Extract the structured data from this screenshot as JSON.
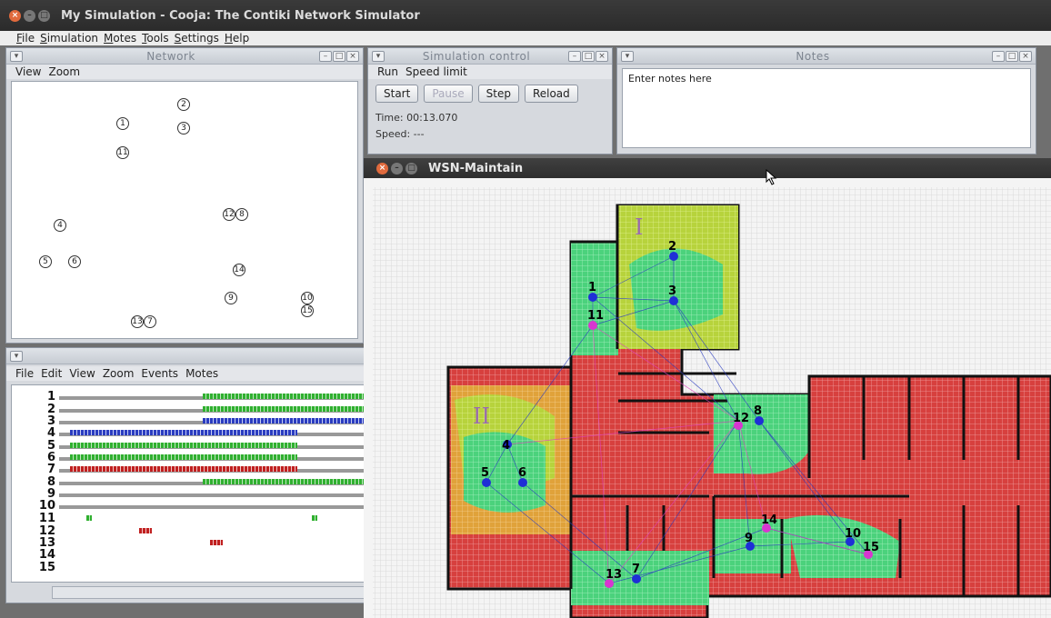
{
  "window": {
    "title": "My Simulation - Cooja: The Contiki Network Simulator"
  },
  "menubar": {
    "items": [
      "File",
      "Simulation",
      "Motes",
      "Tools",
      "Settings",
      "Help"
    ]
  },
  "network": {
    "title": "Network",
    "menu": [
      "View",
      "Zoom"
    ],
    "motes": [
      "1",
      "2",
      "3",
      "11",
      "4",
      "12",
      "8",
      "5",
      "6",
      "14",
      "9",
      "10",
      "15",
      "13",
      "7"
    ]
  },
  "simctl": {
    "title": "Simulation control",
    "menu": [
      "Run",
      "Speed limit"
    ],
    "buttons": {
      "start": "Start",
      "pause": "Pause",
      "step": "Step",
      "reload": "Reload"
    },
    "time": "Time: 00:13.070",
    "speed": "Speed: ---"
  },
  "notes": {
    "title": "Notes",
    "placeholder": "Enter notes here"
  },
  "timeline": {
    "menu": [
      "File",
      "Edit",
      "View",
      "Zoom",
      "Events",
      "Motes"
    ],
    "rows": [
      "1",
      "2",
      "3",
      "4",
      "5",
      "6",
      "7",
      "8",
      "9",
      "10",
      "11",
      "12",
      "13",
      "14",
      "15"
    ]
  },
  "wsn": {
    "title": "WSN-Maintain",
    "regions": [
      "I",
      "II"
    ],
    "node_labels": [
      "2",
      "1",
      "3",
      "11",
      "8",
      "12",
      "4",
      "5",
      "6",
      "14",
      "10",
      "9",
      "15",
      "13",
      "7"
    ]
  },
  "icons": [
    "close-icon",
    "minimize-icon",
    "maximize-icon",
    "menu-dropdown-icon",
    "mouse-cursor-icon"
  ]
}
